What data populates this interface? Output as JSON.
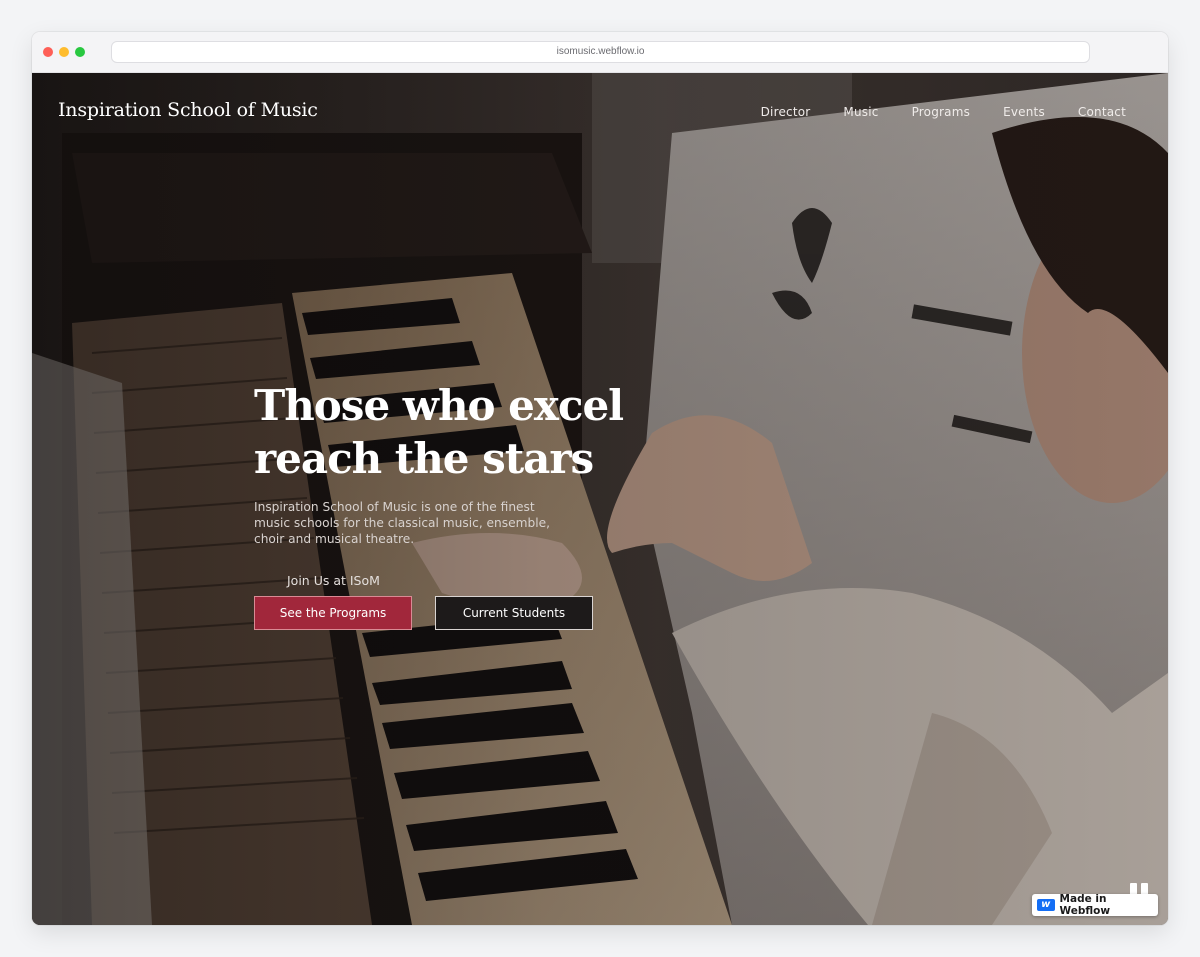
{
  "browser": {
    "url": "isomusic.webflow.io"
  },
  "header": {
    "brand": "Inspiration School of Music",
    "nav": [
      {
        "label": "Director"
      },
      {
        "label": "Music"
      },
      {
        "label": "Programs"
      },
      {
        "label": "Events"
      },
      {
        "label": "Contact"
      }
    ]
  },
  "hero": {
    "title_line1": "Those who excel",
    "title_line2": "reach the stars",
    "description": "Inspiration School of Music is one of the finest music schools for the classical music, ensemble, choir and musical theatre.",
    "join_label": "Join Us at ISoM",
    "primary_button": "See the Programs",
    "secondary_button": "Current Students"
  },
  "badge": {
    "label": "Made in Webflow",
    "icon": "webflow-logo-icon"
  },
  "background": {
    "icon": "pause-icon",
    "description_color": "#a1273b"
  }
}
